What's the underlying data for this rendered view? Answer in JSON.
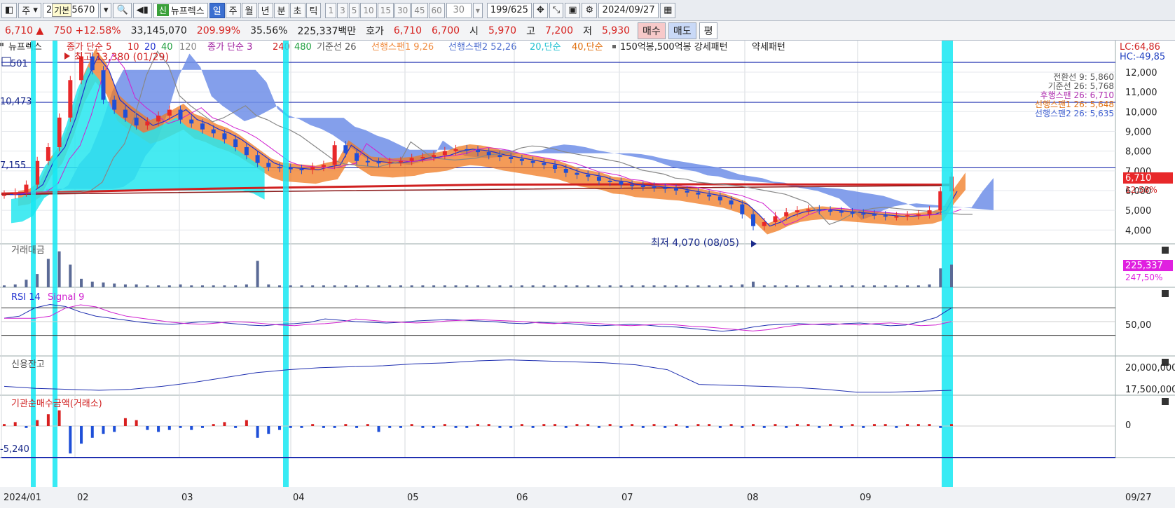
{
  "toolbar": {
    "market": "주",
    "code": "5670",
    "code_prefix": "2",
    "tooltip": "기본",
    "credit_badge": "신",
    "stock_name": "뉴프렉스",
    "periods": [
      "일",
      "주",
      "월",
      "년",
      "분",
      "초",
      "틱"
    ],
    "active_period": "일",
    "intervals": [
      "1",
      "3",
      "5",
      "10",
      "15",
      "30",
      "45",
      "60"
    ],
    "interval_input": "30",
    "count": "199",
    "total": "/625",
    "date": "2024/09/27"
  },
  "infobar": {
    "price": "6,710",
    "change": "750",
    "change_pct": "+12.58%",
    "volume": "33,145,070",
    "vol_ratio": "209.99%",
    "turnover": "35.56%",
    "amount": "225,337백만",
    "quote_label": "호가",
    "ask": "6,710",
    "bid": "6,700",
    "open_label": "시",
    "open": "5,970",
    "high_label": "고",
    "high": "7,200",
    "low_label": "저",
    "low": "5,930",
    "buy": "매수",
    "sell": "매도",
    "avg": "평"
  },
  "legend": {
    "name": "뉴프렉스",
    "ma_label": "종가 단순 5",
    "ma_periods": [
      "10",
      "20",
      "40",
      "120"
    ],
    "ma2_label": "종가 단순 3",
    "ma2_periods": [
      "240",
      "480"
    ],
    "kijun": "기준선 26",
    "span1": "선행스팬1 9,26",
    "span2": "선행스팬2 52,26",
    "sma20": "20,단순",
    "sma40": "40,단순",
    "pattern": "150억봉,500억봉 강세패턴",
    "weak": "약세패턴"
  },
  "right_info": {
    "lc": "LC:64,86",
    "hc": "HC:-49,85"
  },
  "ichimoku_labels": [
    {
      "text": "전환선 9: 5,860",
      "color": "#555555"
    },
    {
      "text": "기준선 26: 5,768",
      "color": "#555555"
    },
    {
      "text": "후행스팬 26: 6,710",
      "color": "#b030b0"
    },
    {
      "text": "선행스팬1 26: 5,648",
      "color": "#e07010"
    },
    {
      "text": "선행스팬2 26: 5,635",
      "color": "#4060d0"
    }
  ],
  "annotations": {
    "high": "최고 13,380 (01/29)",
    "low": "최저 4,070 (08/05)",
    "left_labels": [
      "501",
      "10,473",
      "7,155"
    ],
    "last_price": "6,710",
    "last_pct": "12.58%"
  },
  "panels": {
    "volume": {
      "title": "거래대금",
      "value": "225,337",
      "pct": "247,50%"
    },
    "rsi": {
      "title": "RSI 14",
      "signal": "Signal 9",
      "level": "50,00"
    },
    "credit": {
      "title": "신용잔고",
      "levels": [
        "20,000,000",
        "17,500,000"
      ]
    },
    "inst": {
      "title": "기관순매수금액(거래소)",
      "zero": "0",
      "min": "-5,240"
    }
  },
  "chart_data": {
    "type": "candlestick",
    "x_ticks": [
      "2024/01",
      "02",
      "03",
      "04",
      "05",
      "06",
      "07",
      "08",
      "09"
    ],
    "x_last": "09/27",
    "y_ticks": [
      4000,
      5000,
      6000,
      7000,
      8000,
      9000,
      10000,
      11000,
      12000
    ],
    "y_tick_labels": [
      "4,000",
      "5,000",
      "6,000",
      "7,000",
      "8,000",
      "9,000",
      "10,000",
      "11,000",
      "12,000"
    ],
    "ylim": [
      3300,
      13600
    ],
    "close_series": [
      5800,
      5900,
      6300,
      7500,
      8200,
      9700,
      11600,
      12800,
      12100,
      10600,
      10100,
      9700,
      9300,
      9500,
      9800,
      10100,
      9600,
      9400,
      9100,
      8900,
      8600,
      8200,
      7800,
      7400,
      7200,
      7150,
      7100,
      7050,
      7200,
      7300,
      8300,
      7900,
      7500,
      7450,
      7400,
      7450,
      7500,
      7650,
      7700,
      7800,
      8000,
      8100,
      8050,
      7950,
      7800,
      7700,
      7600,
      7500,
      7400,
      7300,
      7100,
      6900,
      6800,
      6700,
      6500,
      6450,
      6300,
      6250,
      6200,
      6150,
      6100,
      6000,
      5900,
      5800,
      5700,
      5500,
      5300,
      4800,
      4200,
      4400,
      4700,
      4900,
      5000,
      5050,
      5000,
      4950,
      4900,
      4850,
      4800,
      4750,
      4700,
      4700,
      4750,
      4800,
      5000,
      5960,
      6710
    ],
    "rsi_series": [
      55,
      58,
      70,
      75,
      72,
      64,
      58,
      55,
      52,
      49,
      47,
      46,
      48,
      50,
      49,
      47,
      45,
      44,
      46,
      47,
      49,
      54,
      52,
      50,
      49,
      48,
      49,
      51,
      52,
      53,
      52,
      51,
      50,
      48,
      47,
      49,
      48,
      47,
      45,
      44,
      45,
      46,
      45,
      43,
      42,
      40,
      38,
      36,
      38,
      42,
      45,
      46,
      47,
      46,
      45,
      47,
      48,
      46,
      44,
      45,
      50,
      56,
      70
    ],
    "credit_series": [
      17.9,
      17.7,
      17.6,
      17.5,
      17.6,
      17.9,
      18.3,
      18.8,
      19.3,
      19.6,
      19.8,
      19.9,
      20.0,
      20.2,
      20.3,
      20.5,
      20.6,
      20.5,
      20.4,
      20.3,
      20.1,
      19.6,
      18.1,
      18.0,
      17.9,
      17.8,
      17.6,
      17.3,
      17.3,
      17.4,
      17.5
    ],
    "volume_bars": [
      2,
      3,
      8,
      14,
      30,
      38,
      24,
      9,
      6,
      5,
      4,
      3,
      3,
      2,
      2,
      2,
      3,
      2,
      2,
      2,
      2,
      2,
      3,
      28,
      3,
      2,
      2,
      2,
      2,
      2,
      2,
      2,
      2,
      2,
      2,
      2,
      2,
      2,
      2,
      2,
      2,
      2,
      2,
      2,
      2,
      2,
      2,
      2,
      2,
      2,
      2,
      2,
      2,
      2,
      2,
      2,
      2,
      2,
      2,
      2,
      2,
      2,
      2,
      2,
      2,
      2,
      2,
      3,
      6,
      2,
      2,
      2,
      2,
      2,
      2,
      2,
      2,
      2,
      2,
      2,
      2,
      2,
      2,
      2,
      3,
      20,
      24
    ],
    "inst_bars": [
      1,
      2,
      -1,
      3,
      6,
      8,
      -14,
      -9,
      -6,
      -4,
      -3,
      4,
      3,
      -2,
      -3,
      -2,
      -1,
      -2,
      -1,
      1,
      2,
      -1,
      3,
      -6,
      -4,
      -2,
      -1,
      -1,
      1,
      -1,
      -1,
      1,
      -1,
      1,
      -3,
      -1,
      -1,
      1,
      -1,
      -1,
      1,
      -1,
      -1,
      1,
      1,
      -1,
      -1,
      1,
      -1,
      1,
      1,
      -1,
      1,
      1,
      -1,
      1,
      -1,
      1,
      -1,
      1,
      -1,
      1,
      -1,
      1,
      1,
      -1,
      1,
      -1,
      1,
      -1,
      1,
      -1,
      1,
      1,
      -1,
      1,
      -1,
      1,
      -1,
      1,
      1,
      -1,
      1,
      1,
      1,
      -1,
      1
    ],
    "highlight_weeks": [
      "2024/01 wk3",
      "2024/01 wk4",
      "2024/04 wk1",
      "2024/09 wk4"
    ]
  }
}
